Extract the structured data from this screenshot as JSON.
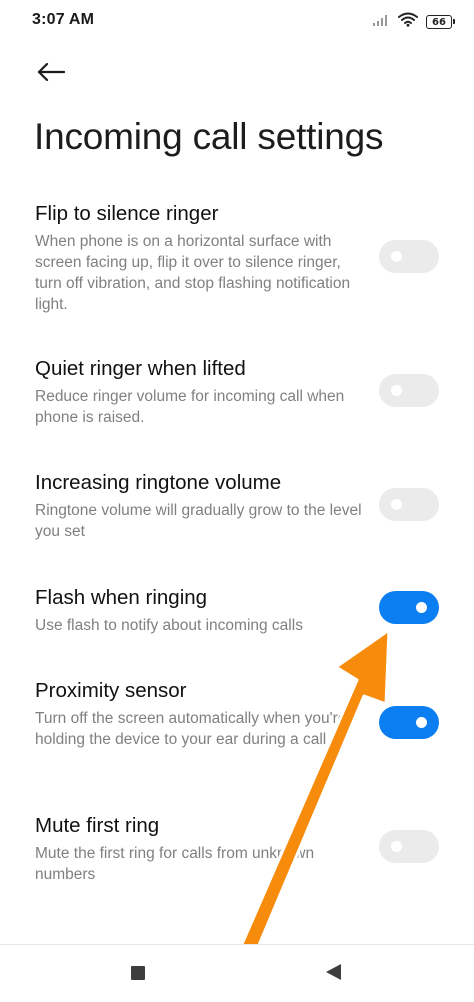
{
  "status_bar": {
    "time": "3:07 AM",
    "battery": "66",
    "icons": [
      "signal-icon",
      "wifi-icon",
      "battery-icon"
    ]
  },
  "header": {
    "back_icon": "back-arrow-icon",
    "title": "Incoming call settings"
  },
  "settings": [
    {
      "title": "Flip to silence ringer",
      "description": "When phone is on a horizontal surface with screen facing up, flip it over to silence ringer, turn off vibration, and stop flashing notification light.",
      "enabled": false
    },
    {
      "title": "Quiet ringer when lifted",
      "description": "Reduce ringer volume for incoming call when phone is raised.",
      "enabled": false
    },
    {
      "title": "Increasing ringtone volume",
      "description": "Ringtone volume will gradually grow to the level you set",
      "enabled": false
    },
    {
      "title": "Flash when ringing",
      "description": "Use flash to notify about incoming calls",
      "enabled": true
    },
    {
      "title": "Proximity sensor",
      "description": "Turn off the screen automatically when you're holding the device to your ear during a call",
      "enabled": true
    },
    {
      "title": "Mute first ring",
      "description": "Mute the first ring for calls from unknown numbers",
      "enabled": false
    }
  ],
  "nav_bar": {
    "icons": [
      "recents-square-icon",
      "back-triangle-icon"
    ]
  },
  "colors": {
    "toggle_on": "#0b7ef2",
    "toggle_off": "#ebebeb",
    "annotation_arrow": "#f78c0c"
  }
}
